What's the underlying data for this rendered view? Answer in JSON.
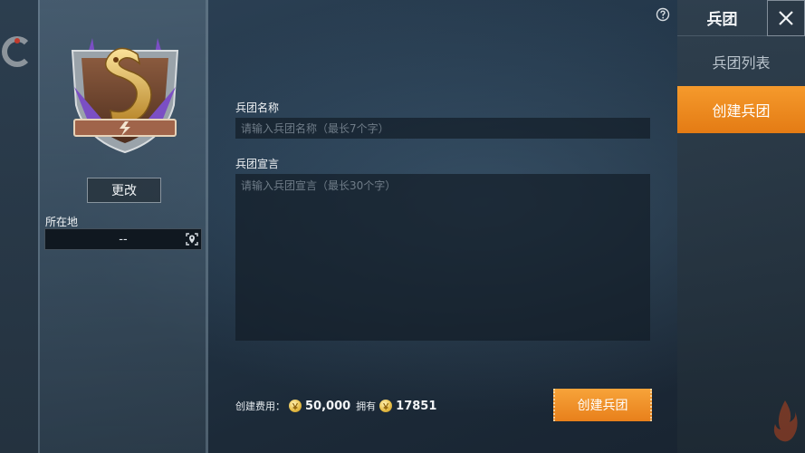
{
  "left_panel": {
    "change_label": "更改",
    "location_label": "所在地",
    "location_value": "--"
  },
  "right_panel": {
    "title": "兵团",
    "tabs": [
      {
        "label": "兵团列表",
        "active": false
      },
      {
        "label": "创建兵团",
        "active": true
      }
    ]
  },
  "form": {
    "name_label": "兵团名称",
    "name_placeholder": "请输入兵团名称（最长7个字）",
    "declaration_label": "兵团宣言",
    "declaration_placeholder": "请输入兵团宣言（最长30个字）"
  },
  "cost": {
    "label": "创建费用：",
    "amount": "50,000",
    "owned_label": "拥有",
    "owned_amount": "17851"
  },
  "create_button_label": "创建兵团",
  "colors": {
    "accent_orange": "#f0901f",
    "gold": "#e8c04a"
  },
  "icons": [
    "help-icon",
    "close-icon",
    "location-icon",
    "coin-icon",
    "dragon-emblem-icon"
  ]
}
